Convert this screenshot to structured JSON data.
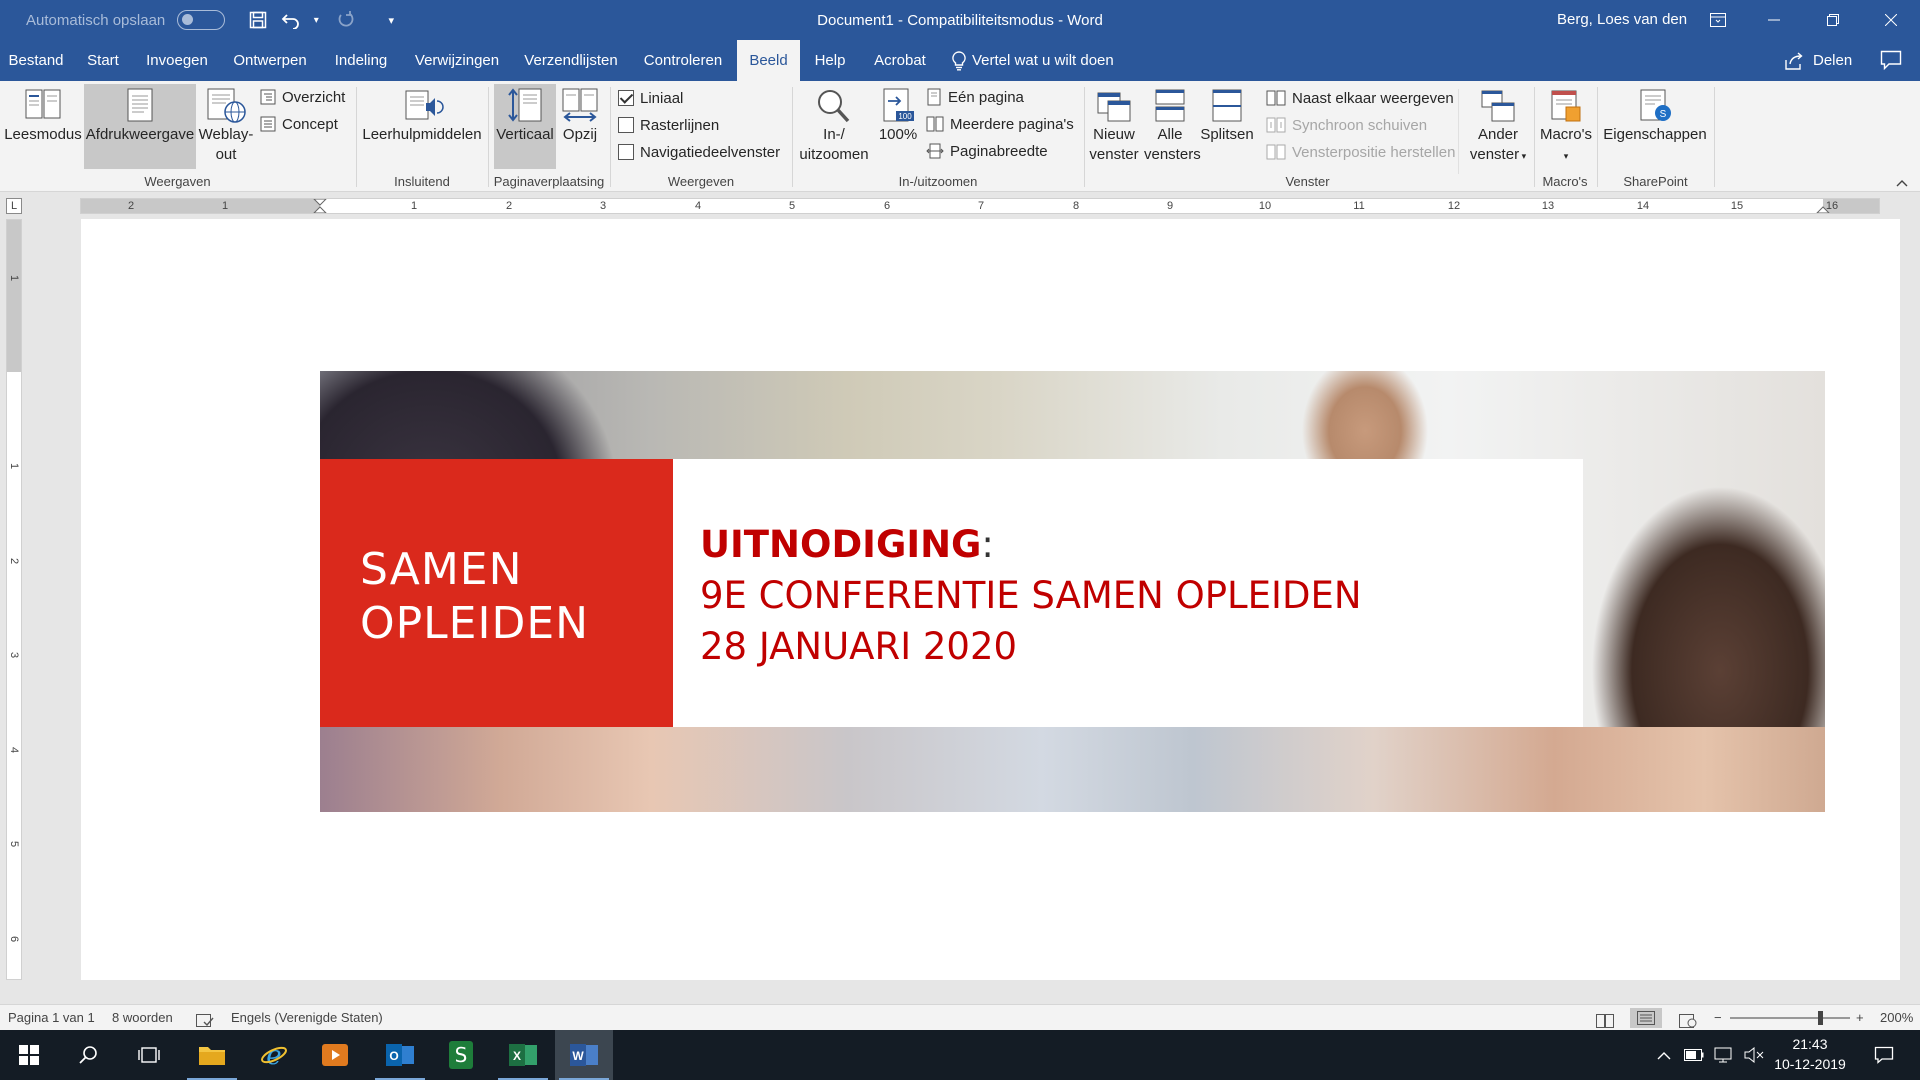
{
  "titlebar": {
    "autosave_label": "Automatisch opslaan",
    "document_title": "Document1  -  Compatibiliteitsmodus  -  Word",
    "user_name": "Berg, Loes van den"
  },
  "tabs": [
    {
      "label": "Bestand"
    },
    {
      "label": "Start"
    },
    {
      "label": "Invoegen"
    },
    {
      "label": "Ontwerpen"
    },
    {
      "label": "Indeling"
    },
    {
      "label": "Verwijzingen"
    },
    {
      "label": "Verzendlijsten"
    },
    {
      "label": "Controleren"
    },
    {
      "label": "Beeld"
    },
    {
      "label": "Help"
    },
    {
      "label": "Acrobat"
    }
  ],
  "tell_me": "Vertel wat u wilt doen",
  "share_label": "Delen",
  "ribbon": {
    "weergaven": {
      "group_label": "Weergaven",
      "leesmodus": "Leesmodus",
      "afdrukweergave": "Afdrukweergave",
      "weblayout_line1": "Weblay-",
      "weblayout_line2": "out",
      "overzicht": "Overzicht",
      "concept": "Concept"
    },
    "insluitend": {
      "group_label": "Insluitend",
      "leerhulpmiddelen": "Leerhulpmiddelen"
    },
    "paginaverplaatsing": {
      "group_label": "Paginaverplaatsing",
      "verticaal": "Verticaal",
      "opzij": "Opzij"
    },
    "weergeven": {
      "group_label": "Weergeven",
      "liniaal": "Liniaal",
      "liniaal_checked": true,
      "rasterlijnen": "Rasterlijnen",
      "navigatie": "Navigatiedeelvenster"
    },
    "zoom": {
      "group_label": "In-/uitzoomen",
      "zoom_line1": "In-/",
      "zoom_line2": "uitzoomen",
      "hundred": "100%",
      "hundred_badge": "100",
      "een_pagina": "Eén pagina",
      "meerdere": "Meerdere pagina's",
      "paginabreedte": "Paginabreedte"
    },
    "venster": {
      "group_label": "Venster",
      "nieuw_line1": "Nieuw",
      "nieuw_line2": "venster",
      "alle_line1": "Alle",
      "alle_line2": "vensters",
      "splitsen": "Splitsen",
      "naast": "Naast elkaar weergeven",
      "synchroon": "Synchroon schuiven",
      "positie": "Vensterpositie herstellen",
      "ander_line1": "Ander",
      "ander_line2": "venster"
    },
    "macros": {
      "group_label": "Macro's",
      "label": "Macro's"
    },
    "sharepoint": {
      "group_label": "SharePoint",
      "eigenschappen": "Eigenschappen"
    }
  },
  "rulers": {
    "horizontal_labels": [
      "2",
      "1",
      "1",
      "1",
      "2",
      "3",
      "4",
      "5",
      "6",
      "7",
      "8",
      "9",
      "10",
      "11",
      "12",
      "13",
      "14",
      "15",
      "16"
    ],
    "vertical_labels": [
      "1",
      "1",
      "2",
      "3",
      "4",
      "5",
      "6"
    ]
  },
  "document": {
    "banner_left_line1": "SAMEN",
    "banner_left_line2": "OPLEIDEN",
    "heading_bold": "UITNODIGING",
    "heading_colon": ":",
    "line2": "9E CONFERENTIE SAMEN OPLEIDEN",
    "line3": "28 JANUARI 2020"
  },
  "statusbar": {
    "page": "Pagina 1 van 1",
    "words": "8 woorden",
    "language": "Engels (Verenigde Staten)",
    "zoom_level": "200%",
    "zoom_fraction": 0.75
  },
  "taskbar": {
    "time": "21:43",
    "date": "10-12-2019"
  },
  "colors": {
    "word_blue": "#2b579a",
    "banner_red": "#da291c",
    "heading_red": "#c00000"
  }
}
